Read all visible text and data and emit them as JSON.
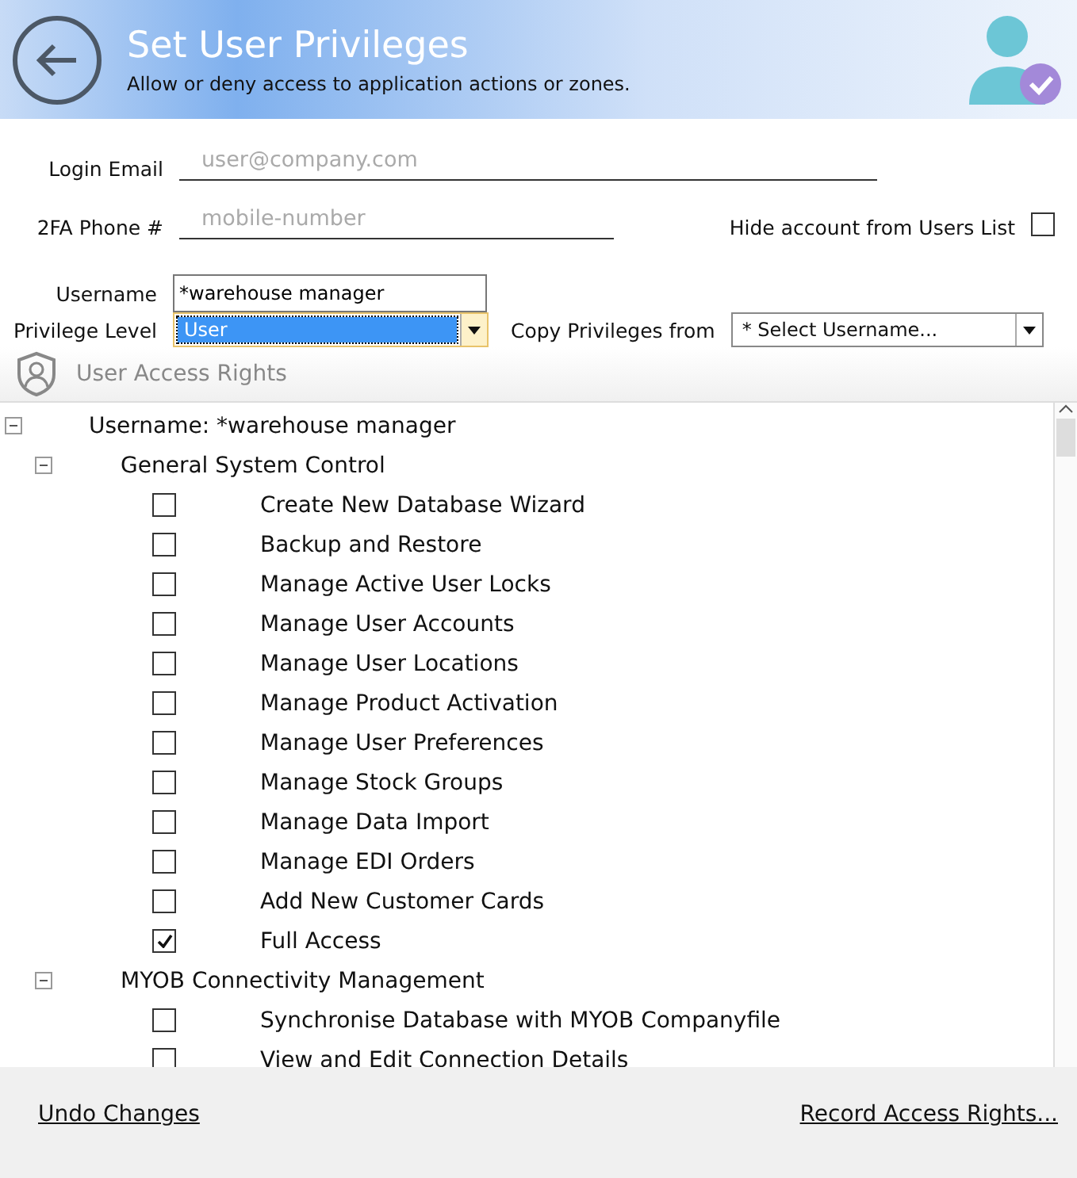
{
  "header": {
    "title": "Set User Privileges",
    "subtitle": "Allow or deny access to application actions or zones."
  },
  "form": {
    "login_email": {
      "label": "Login Email",
      "placeholder": "user@company.com"
    },
    "phone": {
      "label": "2FA Phone #",
      "placeholder": "mobile-number"
    },
    "hide_account": {
      "label": "Hide account from Users List",
      "checked": false
    },
    "username": {
      "label": "Username",
      "value": "*warehouse manager"
    },
    "privilege_level": {
      "label": "Privilege Level",
      "value": "User"
    },
    "copy_privileges": {
      "label": "Copy Privileges from",
      "value": "* Select Username..."
    }
  },
  "section_title": "User Access Rights",
  "tree": [
    {
      "label": "Username: *warehouse manager",
      "expanded": true,
      "children": [
        {
          "label": "General System Control",
          "expanded": true,
          "children": [
            {
              "label": "Create New Database Wizard",
              "checked": false
            },
            {
              "label": "Backup and Restore",
              "checked": false
            },
            {
              "label": "Manage Active User Locks",
              "checked": false
            },
            {
              "label": "Manage User Accounts",
              "checked": false
            },
            {
              "label": "Manage User Locations",
              "checked": false
            },
            {
              "label": "Manage Product Activation",
              "checked": false
            },
            {
              "label": "Manage User Preferences",
              "checked": false
            },
            {
              "label": "Manage Stock Groups",
              "checked": false
            },
            {
              "label": "Manage Data Import",
              "checked": false
            },
            {
              "label": "Manage EDI Orders",
              "checked": false
            },
            {
              "label": "Add New Customer Cards",
              "checked": false
            },
            {
              "label": "Full Access",
              "checked": true
            }
          ]
        },
        {
          "label": "MYOB Connectivity Management",
          "expanded": true,
          "children": [
            {
              "label": "Synchronise Database with MYOB Companyfile",
              "checked": false
            },
            {
              "label": "View and Edit Connection Details",
              "checked": false
            }
          ]
        }
      ]
    }
  ],
  "footer": {
    "undo": "Undo Changes",
    "record": "Record Access Rights..."
  }
}
